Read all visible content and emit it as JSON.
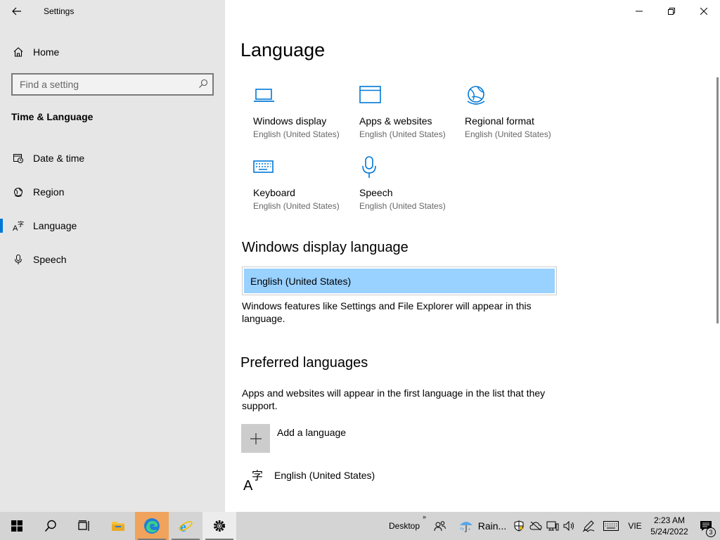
{
  "window": {
    "title": "Settings"
  },
  "sidebar": {
    "home_label": "Home",
    "search_placeholder": "Find a setting",
    "section_title": "Time & Language",
    "items": [
      {
        "label": "Date & time",
        "icon": "date-time-icon"
      },
      {
        "label": "Region",
        "icon": "globe-icon"
      },
      {
        "label": "Language",
        "icon": "language-icon",
        "active": true
      },
      {
        "label": "Speech",
        "icon": "microphone-icon"
      }
    ]
  },
  "main": {
    "title": "Language",
    "tiles": [
      {
        "name": "Windows display",
        "sub": "English (United States)",
        "icon": "laptop-icon"
      },
      {
        "name": "Apps & websites",
        "sub": "English (United States)",
        "icon": "window-icon"
      },
      {
        "name": "Regional format",
        "sub": "English (United States)",
        "icon": "globe-icon"
      },
      {
        "name": "Keyboard",
        "sub": "English (United States)",
        "icon": "keyboard-icon"
      },
      {
        "name": "Speech",
        "sub": "English (United States)",
        "icon": "microphone-icon"
      }
    ],
    "display_language": {
      "heading": "Windows display language",
      "selected": "English (United States)",
      "description": "Windows features like Settings and File Explorer will appear in this language."
    },
    "preferred": {
      "heading": "Preferred languages",
      "description": "Apps and websites will appear in the first language in the list that they support.",
      "add_label": "Add a language",
      "languages": [
        "English (United States)"
      ]
    }
  },
  "taskbar": {
    "desktop_label": "Desktop",
    "weather_label": "Rain...",
    "input_lang": "VIE",
    "time": "2:23 AM",
    "date": "5/24/2022",
    "notification_count": "3",
    "accent": "#0078d7",
    "icons": [
      "windows-start-icon",
      "search-icon",
      "task-view-icon",
      "file-explorer-icon",
      "edge-icon",
      "internet-explorer-icon",
      "settings-gear-icon"
    ]
  }
}
